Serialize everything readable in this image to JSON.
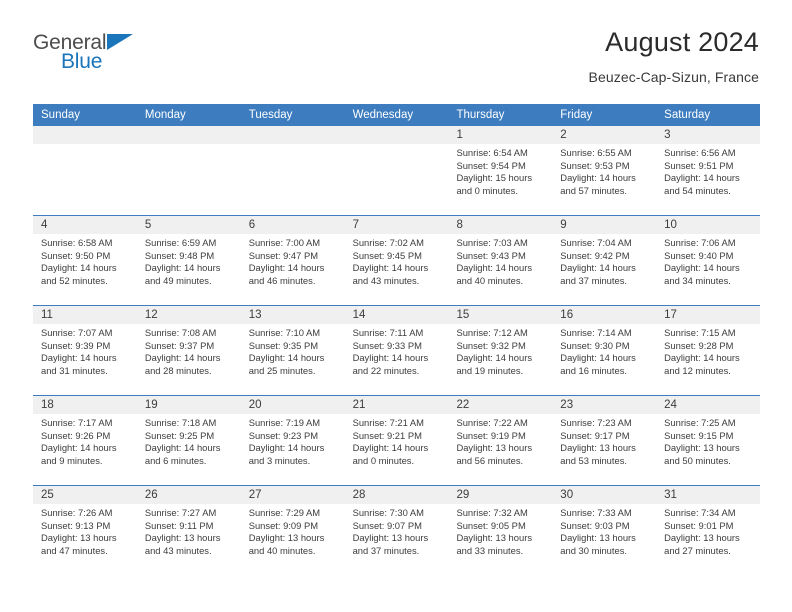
{
  "brand": {
    "name_top": "General",
    "name_bottom": "Blue",
    "triangle_color": "#1b75bb"
  },
  "header": {
    "title": "August 2024",
    "subtitle": "Beuzec-Cap-Sizun, France"
  },
  "theme": {
    "header_blue": "#3c7cbf",
    "day_band_gray": "#f0f0f0",
    "text": "#3c3c3c"
  },
  "labels": {
    "sunrise_prefix": "Sunrise:",
    "sunset_prefix": "Sunset:",
    "daylight_prefix": "Daylight:"
  },
  "weekday_headers": [
    "Sunday",
    "Monday",
    "Tuesday",
    "Wednesday",
    "Thursday",
    "Friday",
    "Saturday"
  ],
  "weeks": [
    [
      {
        "day": "",
        "empty": true
      },
      {
        "day": "",
        "empty": true
      },
      {
        "day": "",
        "empty": true
      },
      {
        "day": "",
        "empty": true
      },
      {
        "day": "1",
        "sunrise": "Sunrise: 6:54 AM",
        "sunset": "Sunset: 9:54 PM",
        "daylight_line1": "Daylight: 15 hours",
        "daylight_line2": "and 0 minutes."
      },
      {
        "day": "2",
        "sunrise": "Sunrise: 6:55 AM",
        "sunset": "Sunset: 9:53 PM",
        "daylight_line1": "Daylight: 14 hours",
        "daylight_line2": "and 57 minutes."
      },
      {
        "day": "3",
        "sunrise": "Sunrise: 6:56 AM",
        "sunset": "Sunset: 9:51 PM",
        "daylight_line1": "Daylight: 14 hours",
        "daylight_line2": "and 54 minutes."
      }
    ],
    [
      {
        "day": "4",
        "sunrise": "Sunrise: 6:58 AM",
        "sunset": "Sunset: 9:50 PM",
        "daylight_line1": "Daylight: 14 hours",
        "daylight_line2": "and 52 minutes."
      },
      {
        "day": "5",
        "sunrise": "Sunrise: 6:59 AM",
        "sunset": "Sunset: 9:48 PM",
        "daylight_line1": "Daylight: 14 hours",
        "daylight_line2": "and 49 minutes."
      },
      {
        "day": "6",
        "sunrise": "Sunrise: 7:00 AM",
        "sunset": "Sunset: 9:47 PM",
        "daylight_line1": "Daylight: 14 hours",
        "daylight_line2": "and 46 minutes."
      },
      {
        "day": "7",
        "sunrise": "Sunrise: 7:02 AM",
        "sunset": "Sunset: 9:45 PM",
        "daylight_line1": "Daylight: 14 hours",
        "daylight_line2": "and 43 minutes."
      },
      {
        "day": "8",
        "sunrise": "Sunrise: 7:03 AM",
        "sunset": "Sunset: 9:43 PM",
        "daylight_line1": "Daylight: 14 hours",
        "daylight_line2": "and 40 minutes."
      },
      {
        "day": "9",
        "sunrise": "Sunrise: 7:04 AM",
        "sunset": "Sunset: 9:42 PM",
        "daylight_line1": "Daylight: 14 hours",
        "daylight_line2": "and 37 minutes."
      },
      {
        "day": "10",
        "sunrise": "Sunrise: 7:06 AM",
        "sunset": "Sunset: 9:40 PM",
        "daylight_line1": "Daylight: 14 hours",
        "daylight_line2": "and 34 minutes."
      }
    ],
    [
      {
        "day": "11",
        "sunrise": "Sunrise: 7:07 AM",
        "sunset": "Sunset: 9:39 PM",
        "daylight_line1": "Daylight: 14 hours",
        "daylight_line2": "and 31 minutes."
      },
      {
        "day": "12",
        "sunrise": "Sunrise: 7:08 AM",
        "sunset": "Sunset: 9:37 PM",
        "daylight_line1": "Daylight: 14 hours",
        "daylight_line2": "and 28 minutes."
      },
      {
        "day": "13",
        "sunrise": "Sunrise: 7:10 AM",
        "sunset": "Sunset: 9:35 PM",
        "daylight_line1": "Daylight: 14 hours",
        "daylight_line2": "and 25 minutes."
      },
      {
        "day": "14",
        "sunrise": "Sunrise: 7:11 AM",
        "sunset": "Sunset: 9:33 PM",
        "daylight_line1": "Daylight: 14 hours",
        "daylight_line2": "and 22 minutes."
      },
      {
        "day": "15",
        "sunrise": "Sunrise: 7:12 AM",
        "sunset": "Sunset: 9:32 PM",
        "daylight_line1": "Daylight: 14 hours",
        "daylight_line2": "and 19 minutes."
      },
      {
        "day": "16",
        "sunrise": "Sunrise: 7:14 AM",
        "sunset": "Sunset: 9:30 PM",
        "daylight_line1": "Daylight: 14 hours",
        "daylight_line2": "and 16 minutes."
      },
      {
        "day": "17",
        "sunrise": "Sunrise: 7:15 AM",
        "sunset": "Sunset: 9:28 PM",
        "daylight_line1": "Daylight: 14 hours",
        "daylight_line2": "and 12 minutes."
      }
    ],
    [
      {
        "day": "18",
        "sunrise": "Sunrise: 7:17 AM",
        "sunset": "Sunset: 9:26 PM",
        "daylight_line1": "Daylight: 14 hours",
        "daylight_line2": "and 9 minutes."
      },
      {
        "day": "19",
        "sunrise": "Sunrise: 7:18 AM",
        "sunset": "Sunset: 9:25 PM",
        "daylight_line1": "Daylight: 14 hours",
        "daylight_line2": "and 6 minutes."
      },
      {
        "day": "20",
        "sunrise": "Sunrise: 7:19 AM",
        "sunset": "Sunset: 9:23 PM",
        "daylight_line1": "Daylight: 14 hours",
        "daylight_line2": "and 3 minutes."
      },
      {
        "day": "21",
        "sunrise": "Sunrise: 7:21 AM",
        "sunset": "Sunset: 9:21 PM",
        "daylight_line1": "Daylight: 14 hours",
        "daylight_line2": "and 0 minutes."
      },
      {
        "day": "22",
        "sunrise": "Sunrise: 7:22 AM",
        "sunset": "Sunset: 9:19 PM",
        "daylight_line1": "Daylight: 13 hours",
        "daylight_line2": "and 56 minutes."
      },
      {
        "day": "23",
        "sunrise": "Sunrise: 7:23 AM",
        "sunset": "Sunset: 9:17 PM",
        "daylight_line1": "Daylight: 13 hours",
        "daylight_line2": "and 53 minutes."
      },
      {
        "day": "24",
        "sunrise": "Sunrise: 7:25 AM",
        "sunset": "Sunset: 9:15 PM",
        "daylight_line1": "Daylight: 13 hours",
        "daylight_line2": "and 50 minutes."
      }
    ],
    [
      {
        "day": "25",
        "sunrise": "Sunrise: 7:26 AM",
        "sunset": "Sunset: 9:13 PM",
        "daylight_line1": "Daylight: 13 hours",
        "daylight_line2": "and 47 minutes."
      },
      {
        "day": "26",
        "sunrise": "Sunrise: 7:27 AM",
        "sunset": "Sunset: 9:11 PM",
        "daylight_line1": "Daylight: 13 hours",
        "daylight_line2": "and 43 minutes."
      },
      {
        "day": "27",
        "sunrise": "Sunrise: 7:29 AM",
        "sunset": "Sunset: 9:09 PM",
        "daylight_line1": "Daylight: 13 hours",
        "daylight_line2": "and 40 minutes."
      },
      {
        "day": "28",
        "sunrise": "Sunrise: 7:30 AM",
        "sunset": "Sunset: 9:07 PM",
        "daylight_line1": "Daylight: 13 hours",
        "daylight_line2": "and 37 minutes."
      },
      {
        "day": "29",
        "sunrise": "Sunrise: 7:32 AM",
        "sunset": "Sunset: 9:05 PM",
        "daylight_line1": "Daylight: 13 hours",
        "daylight_line2": "and 33 minutes."
      },
      {
        "day": "30",
        "sunrise": "Sunrise: 7:33 AM",
        "sunset": "Sunset: 9:03 PM",
        "daylight_line1": "Daylight: 13 hours",
        "daylight_line2": "and 30 minutes."
      },
      {
        "day": "31",
        "sunrise": "Sunrise: 7:34 AM",
        "sunset": "Sunset: 9:01 PM",
        "daylight_line1": "Daylight: 13 hours",
        "daylight_line2": "and 27 minutes."
      }
    ]
  ]
}
